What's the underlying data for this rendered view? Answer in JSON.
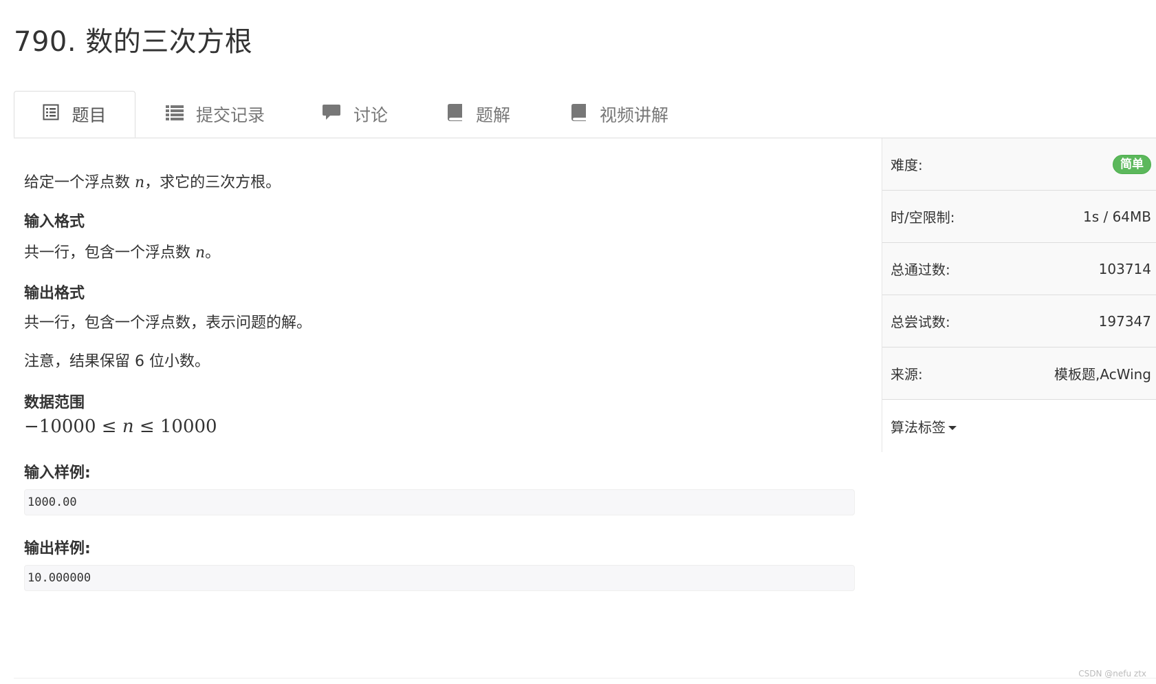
{
  "problem": {
    "title": "790. 数的三次方根"
  },
  "tabs": [
    {
      "label": "题目",
      "icon": "list-alt-icon"
    },
    {
      "label": "提交记录",
      "icon": "list-icon"
    },
    {
      "label": "讨论",
      "icon": "comment-icon"
    },
    {
      "label": "题解",
      "icon": "book-icon"
    },
    {
      "label": "视频讲解",
      "icon": "book-icon"
    }
  ],
  "description": {
    "intro_before": "给定一个浮点数 ",
    "intro_var": "n",
    "intro_after": "，求它的三次方根。",
    "input_heading": "输入格式",
    "input_before": "共一行，包含一个浮点数 ",
    "input_var": "n",
    "input_after": "。",
    "output_heading": "输出格式",
    "output_text": "共一行，包含一个浮点数，表示问题的解。",
    "note_text": "注意，结果保留 6 位小数。",
    "range_heading": "数据范围",
    "range_left": "−10000 ≤ ",
    "range_var": "n",
    "range_right": " ≤ 10000",
    "sample_input_heading": "输入样例:",
    "sample_input": "1000.00",
    "sample_output_heading": "输出样例:",
    "sample_output": "10.000000"
  },
  "sidebar": {
    "difficulty_label": "难度:",
    "difficulty_value": "简单",
    "limit_label": "时/空限制:",
    "limit_value": "1s / 64MB",
    "accepted_label": "总通过数:",
    "accepted_value": "103714",
    "attempts_label": "总尝试数:",
    "attempts_value": "197347",
    "source_label": "来源:",
    "source_value": "模板题,AcWing",
    "tags_label": "算法标签"
  },
  "watermark": "CSDN @nefu ztx",
  "colors": {
    "badge": "#5cb85c",
    "tab_text": "#777777",
    "border": "#dddddd"
  }
}
